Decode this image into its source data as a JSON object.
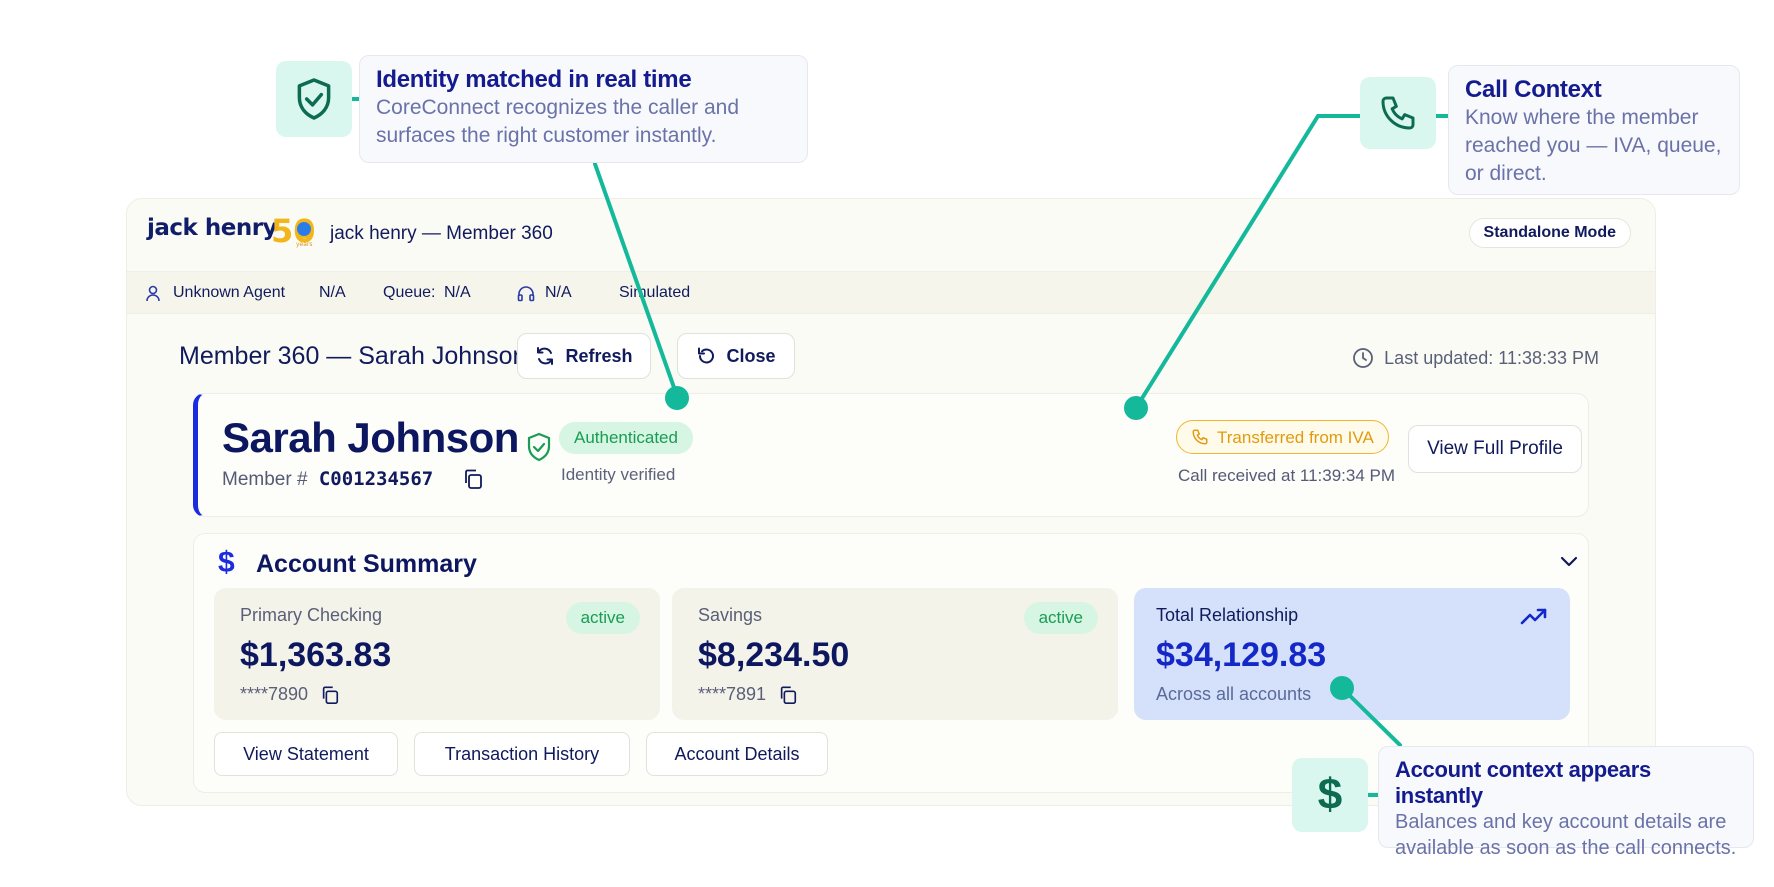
{
  "callouts": {
    "identity": {
      "title": "Identity matched in real time",
      "desc_line1": "CoreConnect recognizes the caller and",
      "desc_line2": "surfaces the right customer instantly."
    },
    "call_context": {
      "title": "Call Context",
      "desc_line1": "Know where the member",
      "desc_line2": "reached you — IVA, queue,",
      "desc_line3": "or direct."
    },
    "account_context": {
      "title": "Account context appears instantly",
      "desc_line1": "Balances and key account details are",
      "desc_line2": "available as soon as the call connects."
    }
  },
  "header": {
    "brand": "jack henry",
    "logo_number": "50",
    "logo_sub": "years",
    "app_title": "jack henry — Member 360",
    "mode": "Standalone Mode"
  },
  "statusbar": {
    "agent": "Unknown Agent",
    "agent_value": "N/A",
    "queue_label": "Queue:",
    "queue_value": "N/A",
    "headset_value": "N/A",
    "mode": "Simulated"
  },
  "page": {
    "title": "Member 360 — Sarah Johnson",
    "refresh_label": "Refresh",
    "close_label": "Close",
    "last_updated": "Last updated: 11:38:33 PM"
  },
  "member": {
    "name": "Sarah Johnson",
    "number_label": "Member #",
    "number": "C001234567",
    "auth_status": "Authenticated",
    "auth_sub": "Identity verified",
    "transfer": "Transferred from IVA",
    "call_time": "Call received at 11:39:34 PM",
    "view_profile": "View Full Profile"
  },
  "account_summary": {
    "title": "Account Summary",
    "accounts": [
      {
        "name": "Primary Checking",
        "balance": "$1,363.83",
        "mask": "****7890",
        "status": "active"
      },
      {
        "name": "Savings",
        "balance": "$8,234.50",
        "mask": "****7891",
        "status": "active"
      }
    ],
    "total": {
      "name": "Total Relationship",
      "balance": "$34,129.83",
      "sub": "Across all accounts"
    },
    "actions": [
      "View Statement",
      "Transaction History",
      "Account Details"
    ]
  },
  "colors": {
    "accent_teal": "#14b89a",
    "brand_blue": "#1b2be0",
    "navy": "#0d1760",
    "success_green": "#1a9c55",
    "warning_amber": "#e39a0f"
  }
}
